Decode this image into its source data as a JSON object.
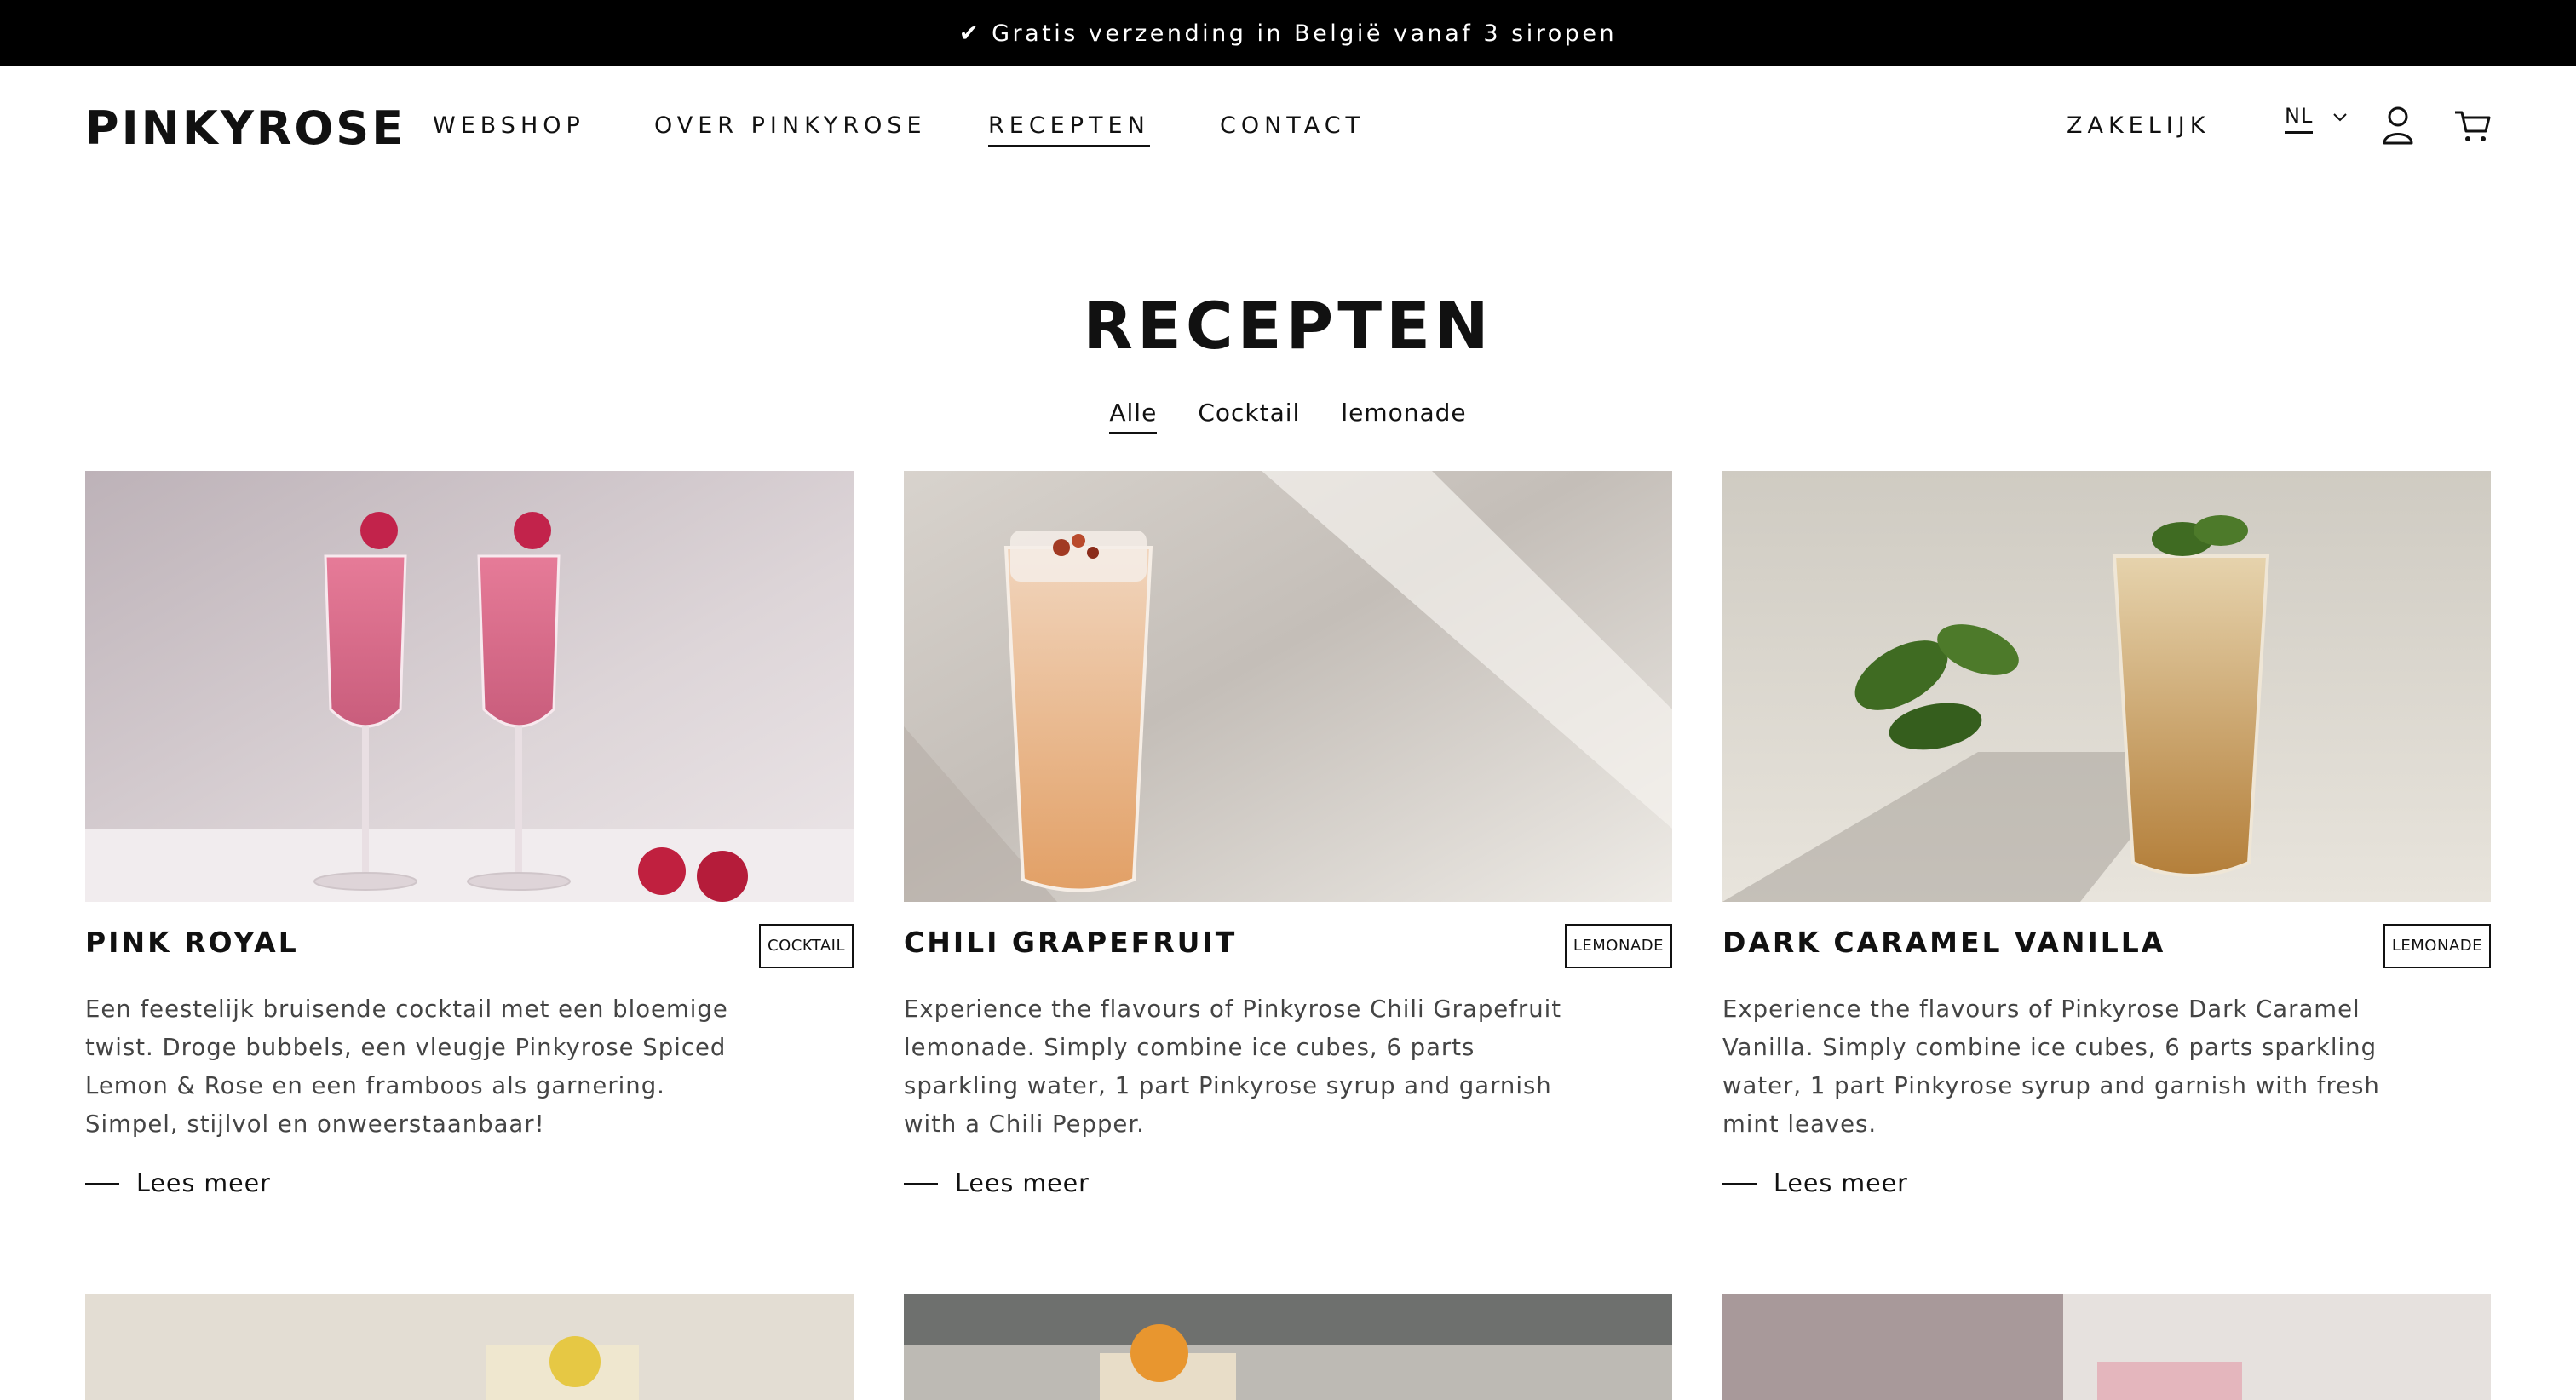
{
  "announcement": "✔ Gratis verzending in België vanaf 3 siropen",
  "header": {
    "logo": "PINKYROSE",
    "nav": [
      "WEBSHOP",
      "OVER PINKYROSE",
      "RECEPTEN",
      "CONTACT"
    ],
    "active_nav": "RECEPTEN",
    "business": "ZAKELIJK",
    "language": "NL"
  },
  "page": {
    "title": "RECEPTEN",
    "filters": [
      "Alle",
      "Cocktail",
      "lemonade"
    ],
    "active_filter": "Alle"
  },
  "cards": [
    {
      "title": "PINK ROYAL",
      "tag": "COCKTAIL",
      "description": "Een feestelijk bruisende cocktail met een bloemige twist. Droge bubbels, een vleugje Pinkyrose Spiced Lemon & Rose en een framboos als garnering. Simpel, stijlvol en onweerstaanbaar!",
      "read_more": "Lees meer"
    },
    {
      "title": "CHILI GRAPEFRUIT",
      "tag": "LEMONADE",
      "description": "Experience the flavours of Pinkyrose Chili Grapefruit lemonade. Simply combine ice cubes, 6 parts sparkling water, 1 part Pinkyrose syrup and garnish with a Chili Pepper.",
      "read_more": "Lees meer"
    },
    {
      "title": "DARK CARAMEL VANILLA",
      "tag": "LEMONADE",
      "description": "Experience the flavours of Pinkyrose Dark Caramel Vanilla. Simply combine ice cubes, 6 parts sparkling water, 1 part Pinkyrose syrup and garnish with fresh mint leaves.",
      "read_more": "Lees meer"
    }
  ],
  "icons": {
    "account": "user-icon",
    "cart": "cart-icon",
    "language_toggle": "chevron-down-icon"
  },
  "colors": {
    "announcement_bg": "#000000",
    "text": "#111111",
    "body_text": "#444444"
  }
}
